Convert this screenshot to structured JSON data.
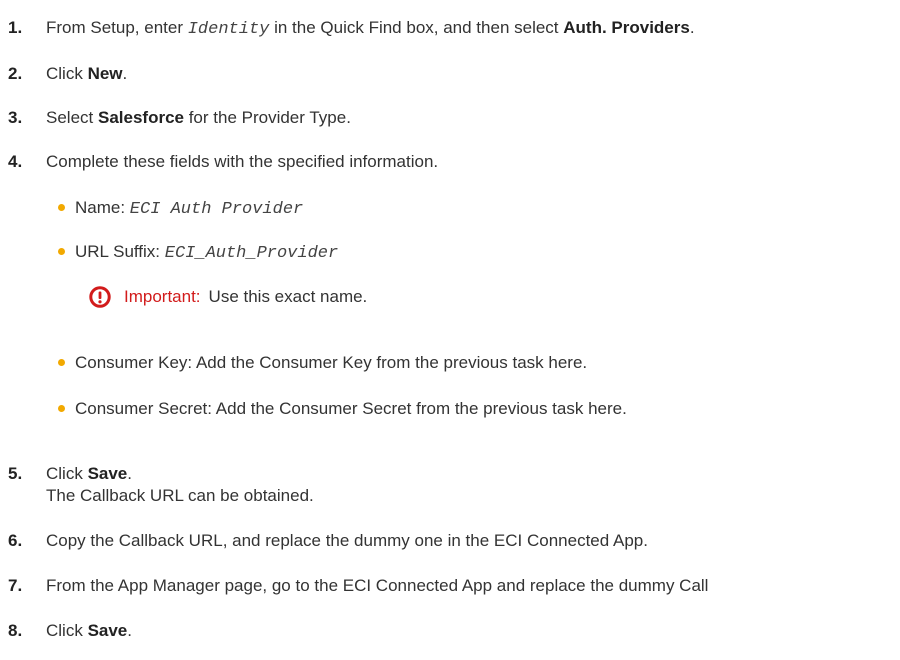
{
  "steps": [
    {
      "num": "1.",
      "pre": "From Setup, enter ",
      "code": "Identity",
      "mid": " in the Quick Find box, and then select ",
      "bold": "Auth. Providers",
      "post": "."
    },
    {
      "num": "2.",
      "pre": "Click ",
      "bold": "New",
      "post": "."
    },
    {
      "num": "3.",
      "pre": "Select ",
      "bold": "Salesforce",
      "post": " for the Provider Type."
    },
    {
      "num": "4.",
      "text": "Complete these fields with the specified information."
    },
    {
      "num": "5.",
      "pre": "Click ",
      "bold": "Save",
      "post": ".",
      "continuation": "The Callback URL can be obtained."
    },
    {
      "num": "6.",
      "text": "Copy the Callback URL, and replace the dummy one in the ECI Connected App."
    },
    {
      "num": "7.",
      "text": "From the App Manager page, go to the ECI Connected App and replace the dummy Call"
    },
    {
      "num": "8.",
      "pre": "Click ",
      "bold": "Save",
      "post": "."
    }
  ],
  "fields": [
    {
      "label": "Name: ",
      "value": "ECI Auth Provider"
    },
    {
      "label": "URL Suffix: ",
      "value": "ECI_Auth_Provider"
    },
    {
      "text": "Consumer Key: Add the Consumer Key from the previous task here."
    },
    {
      "text": "Consumer Secret: Add the Consumer Secret from the previous task here."
    }
  ],
  "note": {
    "icon": "important-icon",
    "label": "Important:",
    "text": "Use this exact name.",
    "color": "#d21b1b"
  },
  "bullet_color": "#f2a900"
}
